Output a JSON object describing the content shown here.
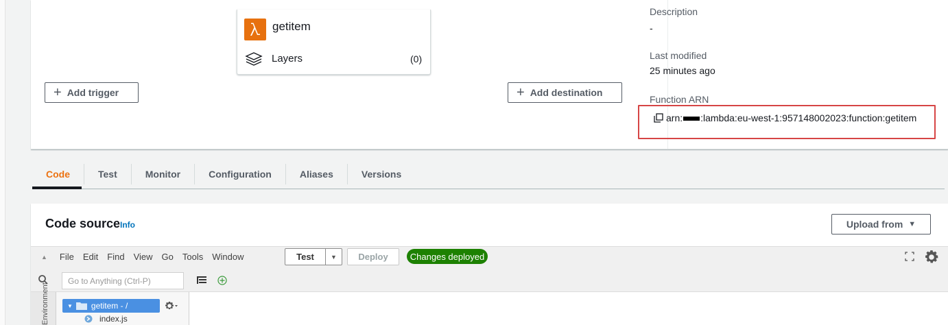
{
  "function": {
    "name": "getitem",
    "layers_label": "Layers",
    "layers_count": "(0)"
  },
  "buttons": {
    "add_trigger": "Add trigger",
    "add_destination": "Add destination",
    "upload_from": "Upload from"
  },
  "details": {
    "description_label": "Description",
    "description_value": "-",
    "last_modified_label": "Last modified",
    "last_modified_value": "25 minutes ago",
    "arn_label": "Function ARN",
    "arn_prefix": "arn:",
    "arn_suffix": ":lambda:eu-west-1:957148002023:function:getitem"
  },
  "tabs": [
    {
      "label": "Code",
      "active": true
    },
    {
      "label": "Test"
    },
    {
      "label": "Monitor"
    },
    {
      "label": "Configuration"
    },
    {
      "label": "Aliases"
    },
    {
      "label": "Versions"
    }
  ],
  "code_source": {
    "title": "Code source",
    "info": "Info"
  },
  "ide": {
    "menu": [
      "File",
      "Edit",
      "Find",
      "View",
      "Go",
      "Tools",
      "Window"
    ],
    "test_label": "Test",
    "deploy_label": "Deploy",
    "status_badge": "Changes deployed",
    "goto_placeholder": "Go to Anything (Ctrl-P)",
    "env_label": "Environment",
    "folder_label": "getitem - /",
    "file_label": "index.js"
  },
  "colors": {
    "accent_orange": "#ec7211",
    "lambda_orange": "#e7710f",
    "success_green": "#1d8102",
    "highlight_red": "#d64545",
    "link_blue": "#0073bb"
  }
}
